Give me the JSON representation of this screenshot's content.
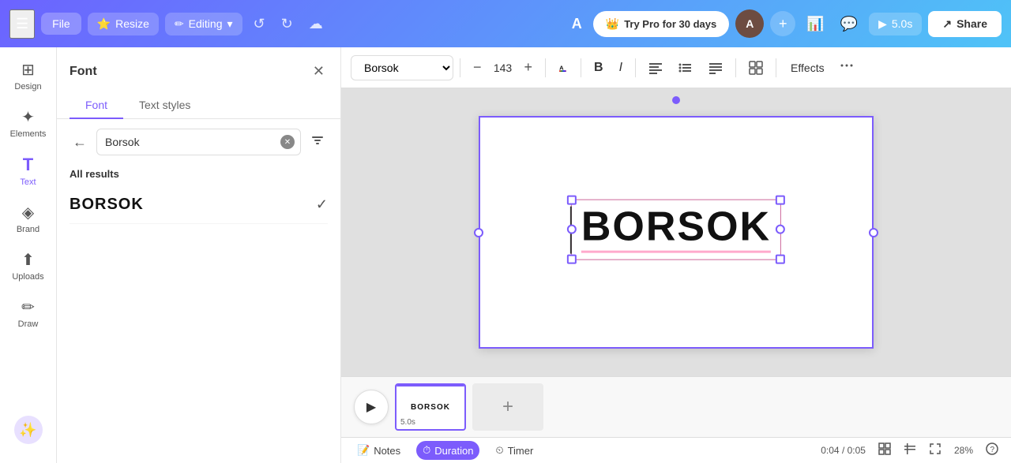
{
  "topnav": {
    "file_label": "File",
    "resize_label": "Resize",
    "editing_label": "Editing",
    "undo_icon": "↺",
    "redo_icon": "↻",
    "cloud_icon": "☁",
    "a_label": "A",
    "pro_label": "Try Pro for 30 days",
    "avatar_label": "A",
    "plus_icon": "+",
    "chart_icon": "📊",
    "comment_icon": "💬",
    "present_label": "5.0s",
    "share_label": "Share",
    "share_icon": "↗"
  },
  "sidebar": {
    "items": [
      {
        "id": "design",
        "label": "Design",
        "icon": "⊞"
      },
      {
        "id": "elements",
        "label": "Elements",
        "icon": "✦"
      },
      {
        "id": "text",
        "label": "Text",
        "icon": "T"
      },
      {
        "id": "brand",
        "label": "Brand",
        "icon": "◈"
      },
      {
        "id": "uploads",
        "label": "Uploads",
        "icon": "⬆"
      },
      {
        "id": "draw",
        "label": "Draw",
        "icon": "✏"
      }
    ]
  },
  "font_panel": {
    "title": "Font",
    "close_icon": "✕",
    "tabs": [
      {
        "id": "font",
        "label": "Font"
      },
      {
        "id": "text_styles",
        "label": "Text styles"
      }
    ],
    "active_tab": "font",
    "back_icon": "←",
    "search_placeholder": "Borsok",
    "search_value": "Borsok",
    "clear_icon": "✕",
    "filter_icon": "⊞",
    "all_results_label": "All results",
    "results": [
      {
        "id": "borsok",
        "name": "BORSOK",
        "selected": true
      }
    ],
    "check_icon": "✓"
  },
  "toolbar": {
    "font_name": "Borsok",
    "minus_icon": "−",
    "font_size": "143",
    "plus_icon": "+",
    "bold_icon": "B",
    "italic_icon": "I",
    "align_icon": "≡",
    "list_icon": "≣",
    "list2_icon": "≣",
    "grid_icon": "⊞",
    "effects_label": "Effects",
    "more_icon": "···"
  },
  "canvas": {
    "main_text": "BORSOK"
  },
  "timeline": {
    "play_icon": "▶",
    "slide": {
      "text": "BORSOK",
      "duration": "5.0s"
    },
    "add_icon": "+",
    "bottom": {
      "notes_icon": "📝",
      "notes_label": "Notes",
      "duration_icon": "⏱",
      "duration_label": "Duration",
      "timer_icon": "⏲",
      "timer_label": "Timer",
      "time_display": "0:04 / 0:05",
      "zoom_label": "28%"
    }
  }
}
